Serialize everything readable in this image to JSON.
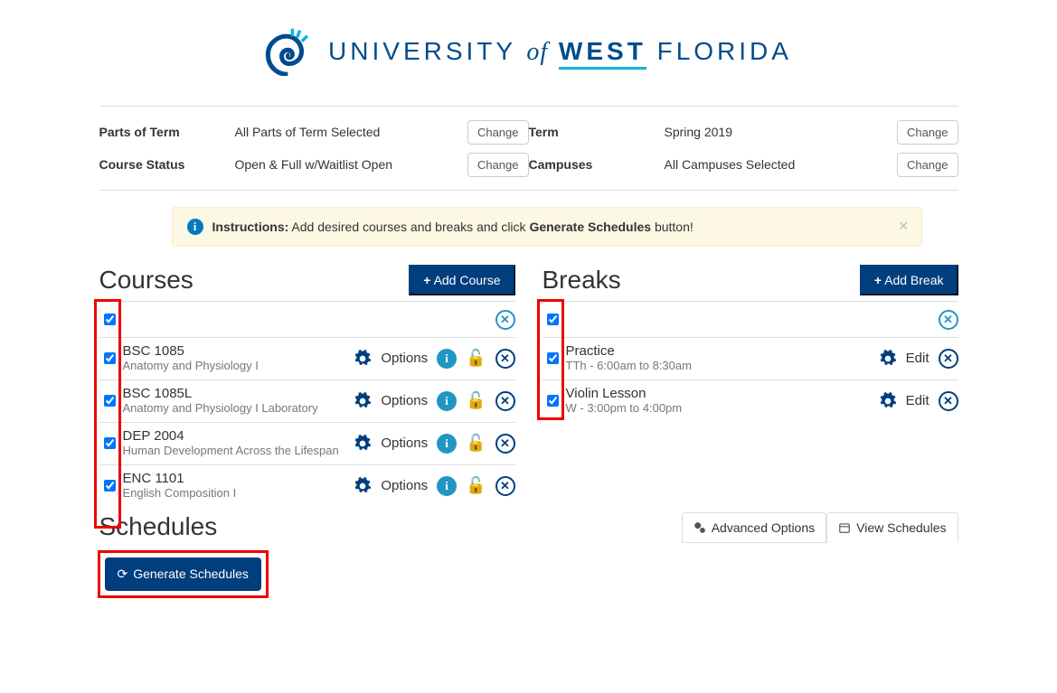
{
  "logo": {
    "line": "UNIVERSITY of WEST FLORIDA"
  },
  "filters": {
    "parts_of_term": {
      "label": "Parts of Term",
      "value": "All Parts of Term Selected",
      "change": "Change"
    },
    "course_status": {
      "label": "Course Status",
      "value": "Open & Full w/Waitlist Open",
      "change": "Change"
    },
    "term": {
      "label": "Term",
      "value": "Spring 2019",
      "change": "Change"
    },
    "campuses": {
      "label": "Campuses",
      "value": "All Campuses Selected",
      "change": "Change"
    }
  },
  "instructions": {
    "lead": "Instructions:",
    "pre": " Add desired courses and breaks and click ",
    "bold": "Generate Schedules",
    "post": " button!"
  },
  "courses": {
    "title": "Courses",
    "add_label": "Add Course",
    "option_label": "Options",
    "items": [
      {
        "code": "BSC 1085",
        "desc": "Anatomy and Physiology I"
      },
      {
        "code": "BSC 1085L",
        "desc": "Anatomy and Physiology I Laboratory"
      },
      {
        "code": "DEP 2004",
        "desc": "Human Development Across the Lifespan"
      },
      {
        "code": "ENC 1101",
        "desc": "English Composition I"
      }
    ]
  },
  "breaks": {
    "title": "Breaks",
    "add_label": "Add Break",
    "edit_label": "Edit",
    "items": [
      {
        "name": "Practice",
        "time": "TTh - 6:00am to 8:30am"
      },
      {
        "name": "Violin Lesson",
        "time": "W - 3:00pm to 4:00pm"
      }
    ]
  },
  "schedules": {
    "title": "Schedules",
    "generate": "Generate Schedules",
    "advanced": "Advanced Options",
    "view": "View Schedules"
  }
}
